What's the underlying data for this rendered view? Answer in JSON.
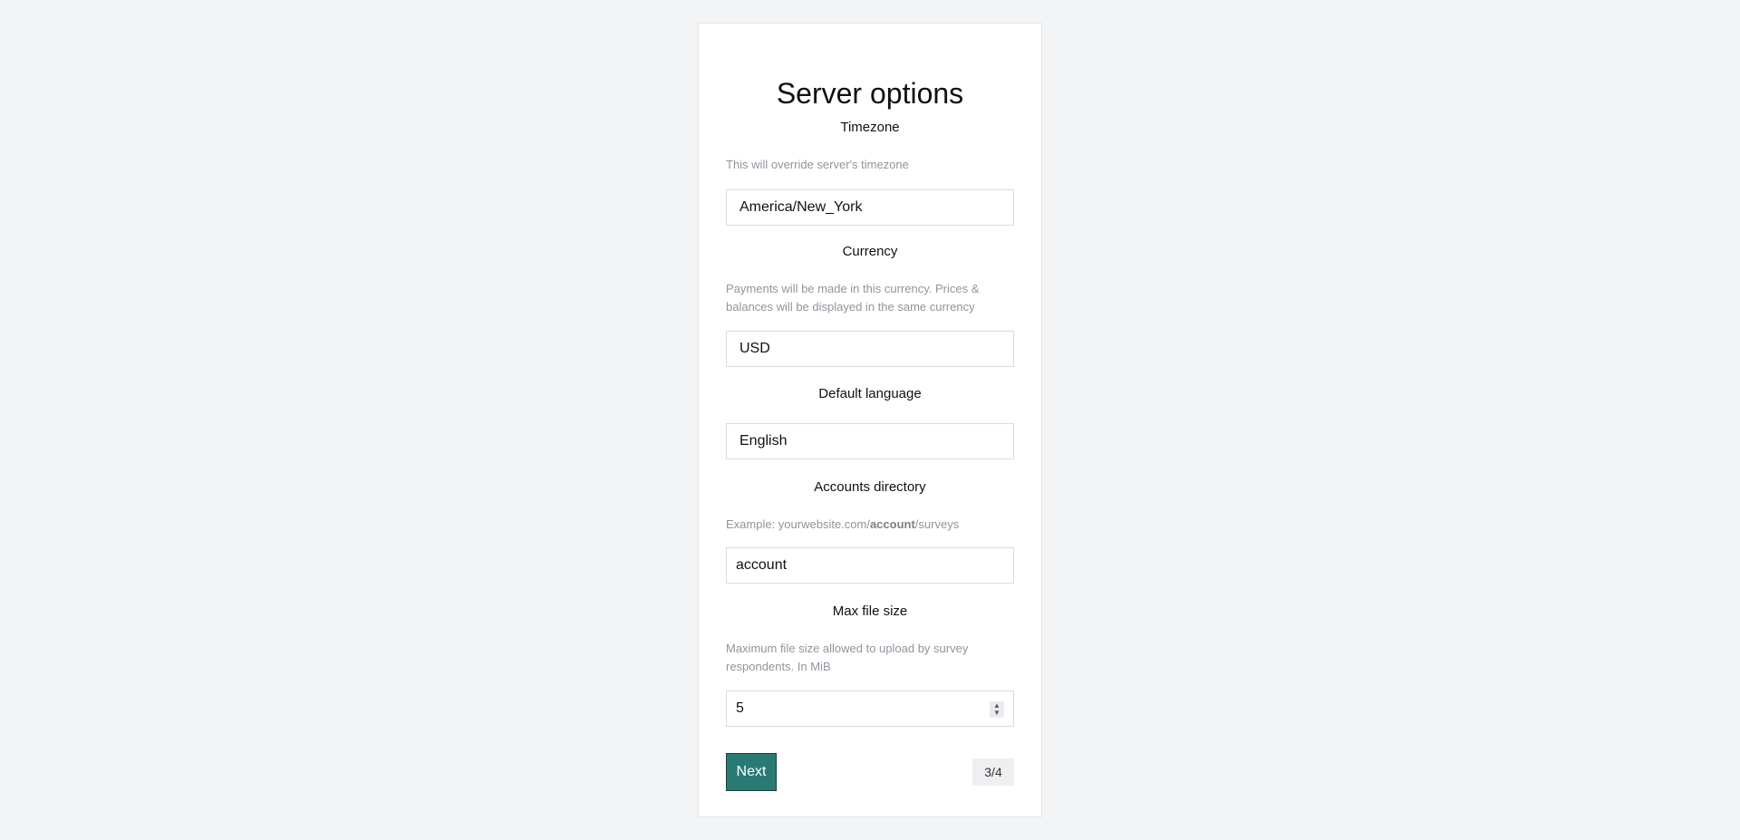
{
  "page": {
    "title": "Server options"
  },
  "form": {
    "timezone": {
      "label": "Timezone",
      "help": "This will override server's timezone",
      "value": "America/New_York"
    },
    "currency": {
      "label": "Currency",
      "help": "Payments will be made in this currency. Prices & balances will be displayed in the same currency",
      "value": "USD"
    },
    "language": {
      "label": "Default language",
      "value": "English"
    },
    "accounts_directory": {
      "label": "Accounts directory",
      "help_prefix": "Example: yourwebsite.com/",
      "help_bold": "account",
      "help_suffix": "/surveys",
      "value": "account"
    },
    "max_file_size": {
      "label": "Max file size",
      "help": "Maximum file size allowed to upload by survey respondents. In MiB",
      "value": "5"
    }
  },
  "footer": {
    "next_label": "Next",
    "step": "3/4"
  },
  "colors": {
    "background": "#f3f4f6",
    "accent": "#2a7a74"
  }
}
